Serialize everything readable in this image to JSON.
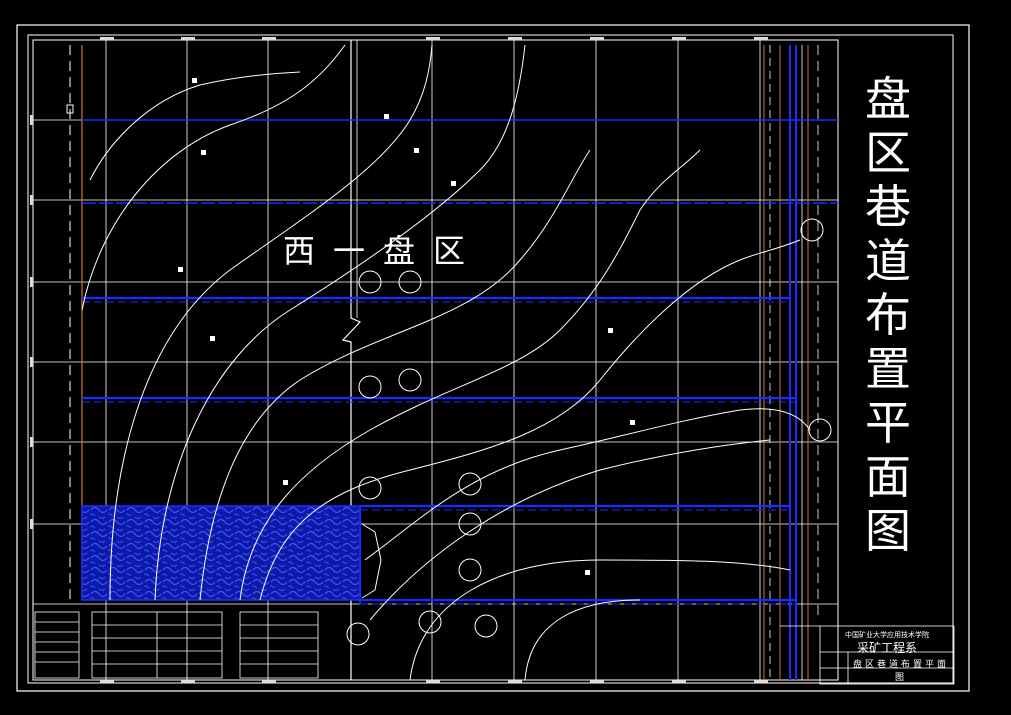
{
  "drawing": {
    "title_chars": [
      "盘",
      "区",
      "巷",
      "道",
      "布",
      "置",
      "平",
      "面",
      "图"
    ],
    "region_label": "西一盘区",
    "title_block": {
      "school": "中国矿业大学应用技术学院",
      "department": "采矿工程系",
      "drawing_name": "盘区巷道布置平面图"
    }
  },
  "colors": {
    "background": "#000000",
    "grid": "#ffffff",
    "roadway": "#1a2cff",
    "goaf_fill": "#1020c8",
    "boundary": "#c87a2a"
  }
}
